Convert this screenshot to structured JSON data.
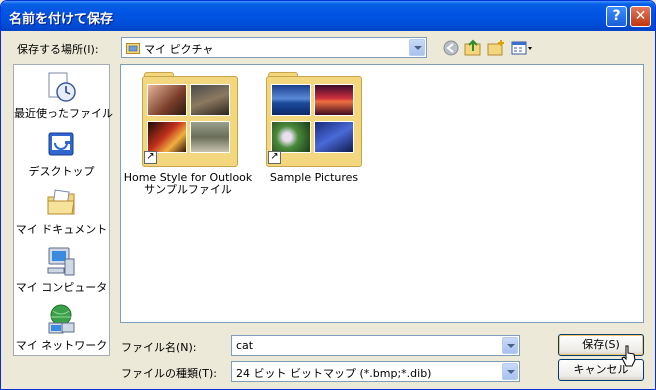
{
  "window": {
    "title": "名前を付けて保存"
  },
  "look_in": {
    "label": "保存する場所(I):",
    "value": "マイ ピクチャ"
  },
  "toolbar": {
    "icons": [
      "back-icon",
      "up-folder-icon",
      "new-folder-icon",
      "view-menu-icon"
    ]
  },
  "places": [
    {
      "label": "最近使ったファイル",
      "icon": "recent-documents-icon"
    },
    {
      "label": "デスクトップ",
      "icon": "desktop-icon"
    },
    {
      "label": "マイ ドキュメント",
      "icon": "my-documents-icon"
    },
    {
      "label": "マイ コンピュータ",
      "icon": "my-computer-icon"
    },
    {
      "label": "マイ ネットワーク",
      "icon": "my-network-icon"
    }
  ],
  "files": [
    {
      "line1": "Home Style for Outlook",
      "line2": "サンプルファイル"
    },
    {
      "line1": "Sample Pictures",
      "line2": ""
    }
  ],
  "filename": {
    "label": "ファイル名(N):",
    "value": "cat"
  },
  "filetype": {
    "label": "ファイルの種類(T):",
    "value": "24 ビット ビットマップ (*.bmp;*.dib)"
  },
  "buttons": {
    "save": "保存(S)",
    "cancel": "キャンセル"
  },
  "colors": {
    "titlebar": "#0054E3",
    "dialog_bg": "#ECE9D8",
    "folder": "#F3D77E",
    "border": "#7F9DB9"
  }
}
